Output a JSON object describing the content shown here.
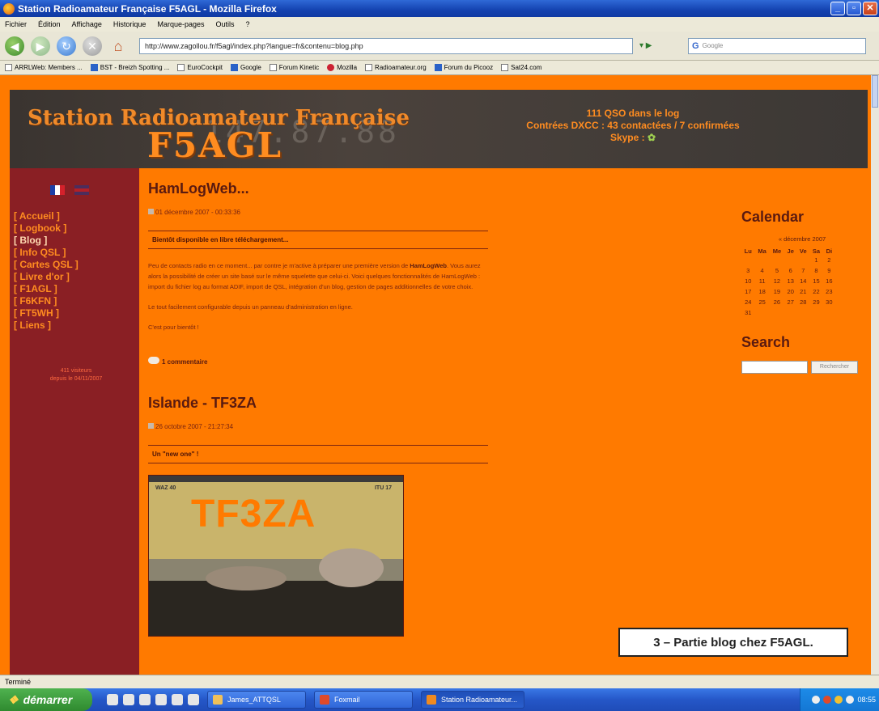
{
  "window": {
    "title": "Station Radioamateur Française F5AGL - Mozilla Firefox"
  },
  "menu": [
    "Fichier",
    "Édition",
    "Affichage",
    "Historique",
    "Marque-pages",
    "Outils",
    "?"
  ],
  "address": {
    "url": "http://www.zagollou.fr/f5agl/index.php?langue=fr&contenu=blog.php",
    "search_placeholder": "Google"
  },
  "bookmarks": [
    "ARRLWeb: Members ...",
    "BST - Breizh Spotting ...",
    "EuroCockpit",
    "Google",
    "Forum Kinetic",
    "Mozilla",
    "Radioamateur.org",
    "Forum du Picooz",
    "Sat24.com"
  ],
  "header": {
    "logo_line1": "Station Radioamateur Française",
    "logo_line2": "F5AGL",
    "digits": "147.87.88",
    "stat1": "111 QSO dans le log",
    "stat2": "Contrées DXCC : 43 contactées / 7 confirmées",
    "stat3": "Skype :"
  },
  "sidebar": {
    "nav": [
      "[ Accueil ]",
      "[ Logbook ]",
      "[ Blog ]",
      "[ Info QSL ]",
      "[ Cartes QSL ]",
      "[ Livre d'or ]",
      "[ F1AGL ]",
      "[ F6KFN ]",
      "[ FT5WH ]",
      "[ Liens ]"
    ],
    "visitors_line1": "411 visiteurs",
    "visitors_line2": "depuis le 04/11/2007"
  },
  "posts": [
    {
      "title": "HamLogWeb...",
      "date": "01 décembre 2007 - 00:33:36",
      "subtitle": "Bientôt disponible en libre téléchargement...",
      "p1": "Peu de contacts radio en ce moment... par contre je m'active à préparer une première version de",
      "p1_bold": "HamLogWeb",
      "p1_rest": ". Vous aurez alors la possibilité de créer un site basé sur le même squelette que celui-ci. Voici quelques fonctionnalités de HamLogWeb : import du fichier log au format ADIF, import de QSL, intégration d'un blog, gestion de pages additionnelles de votre choix.",
      "p2": "Le tout facilement configurable depuis un panneau d'administration en ligne.",
      "p3": "C'est pour bientôt !",
      "comments": "1 commentaire"
    },
    {
      "title": "Islande - TF3ZA",
      "date": "26 octobre 2007 - 21:27:34",
      "subtitle": "Un \"new one\" !",
      "qsl_call": "TF3ZA",
      "qsl_left": "WAZ 40",
      "qsl_right": "ITU 17"
    }
  ],
  "calendar": {
    "heading": "Calendar",
    "month": "« décembre 2007",
    "days": [
      "Lu",
      "Ma",
      "Me",
      "Je",
      "Ve",
      "Sa",
      "Di"
    ],
    "weeks": [
      [
        "",
        "",
        "",
        "",
        "",
        "1",
        "2"
      ],
      [
        "3",
        "4",
        "5",
        "6",
        "7",
        "8",
        "9"
      ],
      [
        "10",
        "11",
        "12",
        "13",
        "14",
        "15",
        "16"
      ],
      [
        "17",
        "18",
        "19",
        "20",
        "21",
        "22",
        "23"
      ],
      [
        "24",
        "25",
        "26",
        "27",
        "28",
        "29",
        "30"
      ],
      [
        "31",
        "",
        "",
        "",
        "",
        "",
        ""
      ]
    ]
  },
  "search": {
    "heading": "Search",
    "button": "Rechercher"
  },
  "caption": "3 – Partie blog chez F5AGL.",
  "status": "Terminé",
  "taskbar": {
    "start": "démarrer",
    "items": [
      "James_ATTQSL",
      "Foxmail",
      "Station Radioamateur..."
    ],
    "clock": "08:55"
  }
}
